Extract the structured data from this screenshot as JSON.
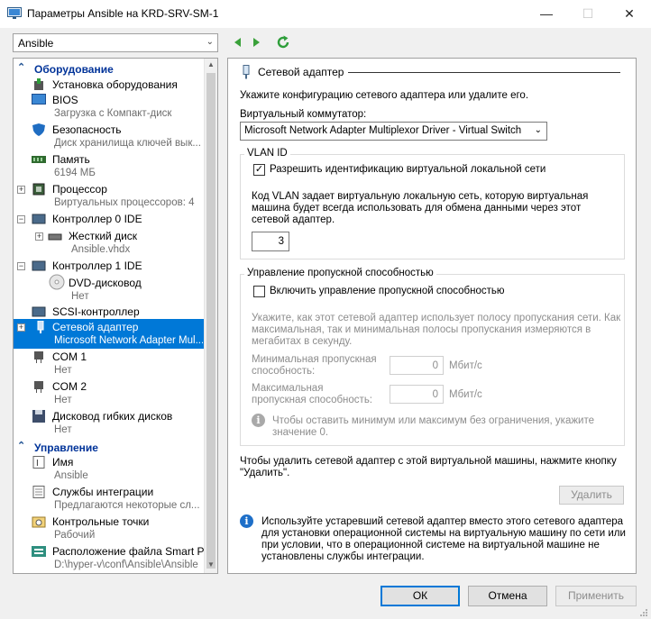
{
  "window": {
    "title": "Параметры Ansible на KRD-SRV-SM-1",
    "minimize": "—",
    "maximize": "☐",
    "close": "✕"
  },
  "vm_selector": {
    "value": "Ansible"
  },
  "sections": {
    "hardware": "Оборудование",
    "management": "Управление"
  },
  "hardware_items": [
    {
      "name": "Установка оборудования",
      "sub": ""
    },
    {
      "name": "BIOS",
      "sub": "Загрузка с Компакт-диск"
    },
    {
      "name": "Безопасность",
      "sub": "Диск хранилища ключей вык..."
    },
    {
      "name": "Память",
      "sub": "6194 МБ"
    },
    {
      "name": "Процессор",
      "sub": "Виртуальных процессоров: 4"
    },
    {
      "name": "Контроллер 0 IDE",
      "sub": ""
    },
    {
      "name": "Жесткий диск",
      "sub": "Ansible.vhdx"
    },
    {
      "name": "Контроллер 1 IDE",
      "sub": ""
    },
    {
      "name": "DVD-дисковод",
      "sub": "Нет"
    },
    {
      "name": "SCSI-контроллер",
      "sub": ""
    },
    {
      "name": "Сетевой адаптер",
      "sub": "Microsoft Network Adapter Mul..."
    },
    {
      "name": "COM 1",
      "sub": "Нет"
    },
    {
      "name": "COM 2",
      "sub": "Нет"
    },
    {
      "name": "Дисковод гибких дисков",
      "sub": "Нет"
    }
  ],
  "management_items": [
    {
      "name": "Имя",
      "sub": "Ansible"
    },
    {
      "name": "Службы интеграции",
      "sub": "Предлагаются некоторые сл..."
    },
    {
      "name": "Контрольные точки",
      "sub": "Рабочий"
    },
    {
      "name": "Расположение файла Smart P...",
      "sub": "D:\\hyper-v\\conf\\Ansible\\Ansible"
    }
  ],
  "panel": {
    "title": "Сетевой адаптер",
    "intro": "Укажите конфигурацию сетевого адаптера или удалите его.",
    "switch_label": "Виртуальный коммутатор:",
    "switch_value": "Microsoft Network Adapter Multiplexor Driver - Virtual Switch",
    "vlan": {
      "legend": "VLAN ID",
      "checkbox_label": "Разрешить идентификацию виртуальной локальной сети",
      "checked": true,
      "description": "Код VLAN задает виртуальную локальную сеть, которую виртуальная машина будет всегда использовать для обмена данными через этот сетевой адаптер.",
      "value": "3"
    },
    "bandwidth": {
      "legend": "Управление пропускной способностью",
      "checkbox_label": "Включить управление пропускной способностью",
      "checked": false,
      "description": "Укажите, как этот сетевой адаптер использует полосу пропускания сети. Как максимальная, так и минимальная полосы пропускания измеряются в мегабитах в секунду.",
      "min_label": "Минимальная пропускная способность:",
      "min_value": "0",
      "max_label": "Максимальная пропускная способность:",
      "max_value": "0",
      "unit": "Мбит/с",
      "hint": "Чтобы оставить минимум или максимум без ограничения, укажите значение 0."
    },
    "remove_text": "Чтобы удалить сетевой адаптер с этой виртуальной машины, нажмите кнопку \"Удалить\".",
    "remove_button": "Удалить",
    "legacy_info": "Используйте устаревший сетевой адаптер вместо этого сетевого адаптера для установки операционной системы на виртуальную машину по сети или при условии, что в операционной системе на виртуальной машине не установлены службы интеграции."
  },
  "buttons": {
    "ok": "ОК",
    "cancel": "Отмена",
    "apply": "Применить"
  },
  "colors": {
    "selection": "#0078d7",
    "section_header": "#003399",
    "info": "#1e6fc8"
  }
}
